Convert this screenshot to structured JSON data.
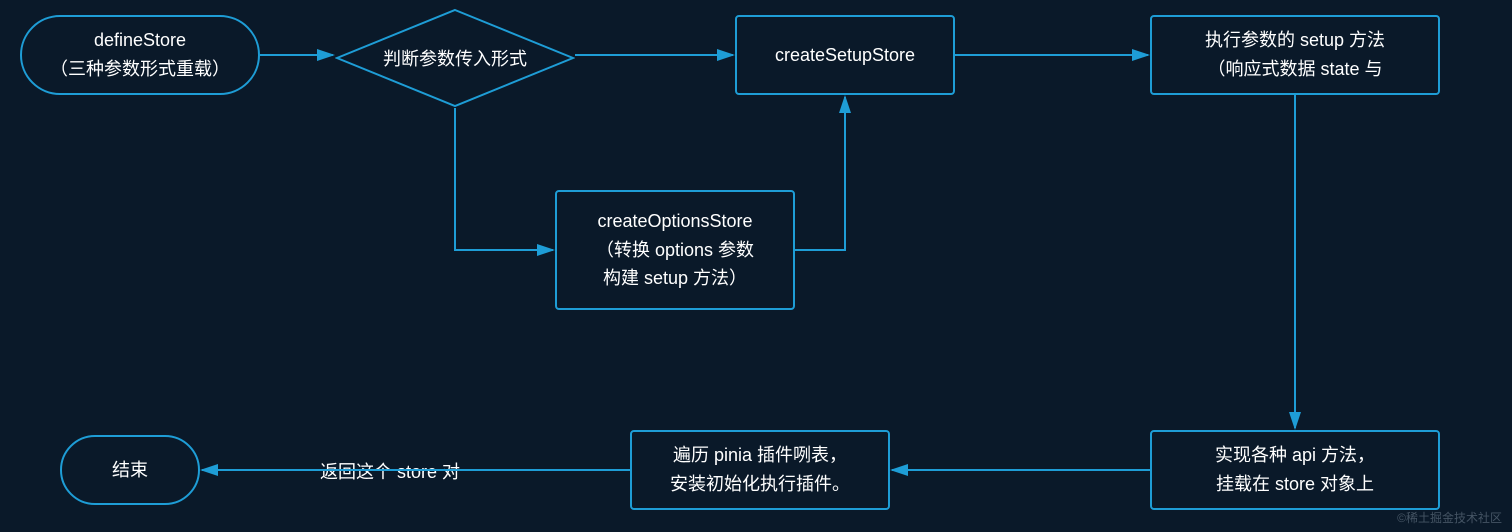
{
  "nodes": {
    "start": {
      "line1": "defineStore",
      "line2": "（三种参数形式重载）"
    },
    "decision": "判断参数传入形式",
    "setupStore": "createSetupStore",
    "execSetup": {
      "line1": "执行参数的 setup 方法",
      "line2": "（响应式数据 state 与"
    },
    "optionsStore": {
      "line1": "createOptionsStore",
      "line2": "（转换 options 参数",
      "line3": "构建 setup 方法）"
    },
    "apiMethods": {
      "line1": "实现各种 api 方法，",
      "line2": "挂载在 store 对象上"
    },
    "plugins": {
      "line1": "遍历 pinia 插件咧表，",
      "line2": "安装初始化执行插件。"
    },
    "returnLabel": "返回这个 store 对",
    "end": "结束"
  },
  "watermark": "©稀土掘金技术社区"
}
